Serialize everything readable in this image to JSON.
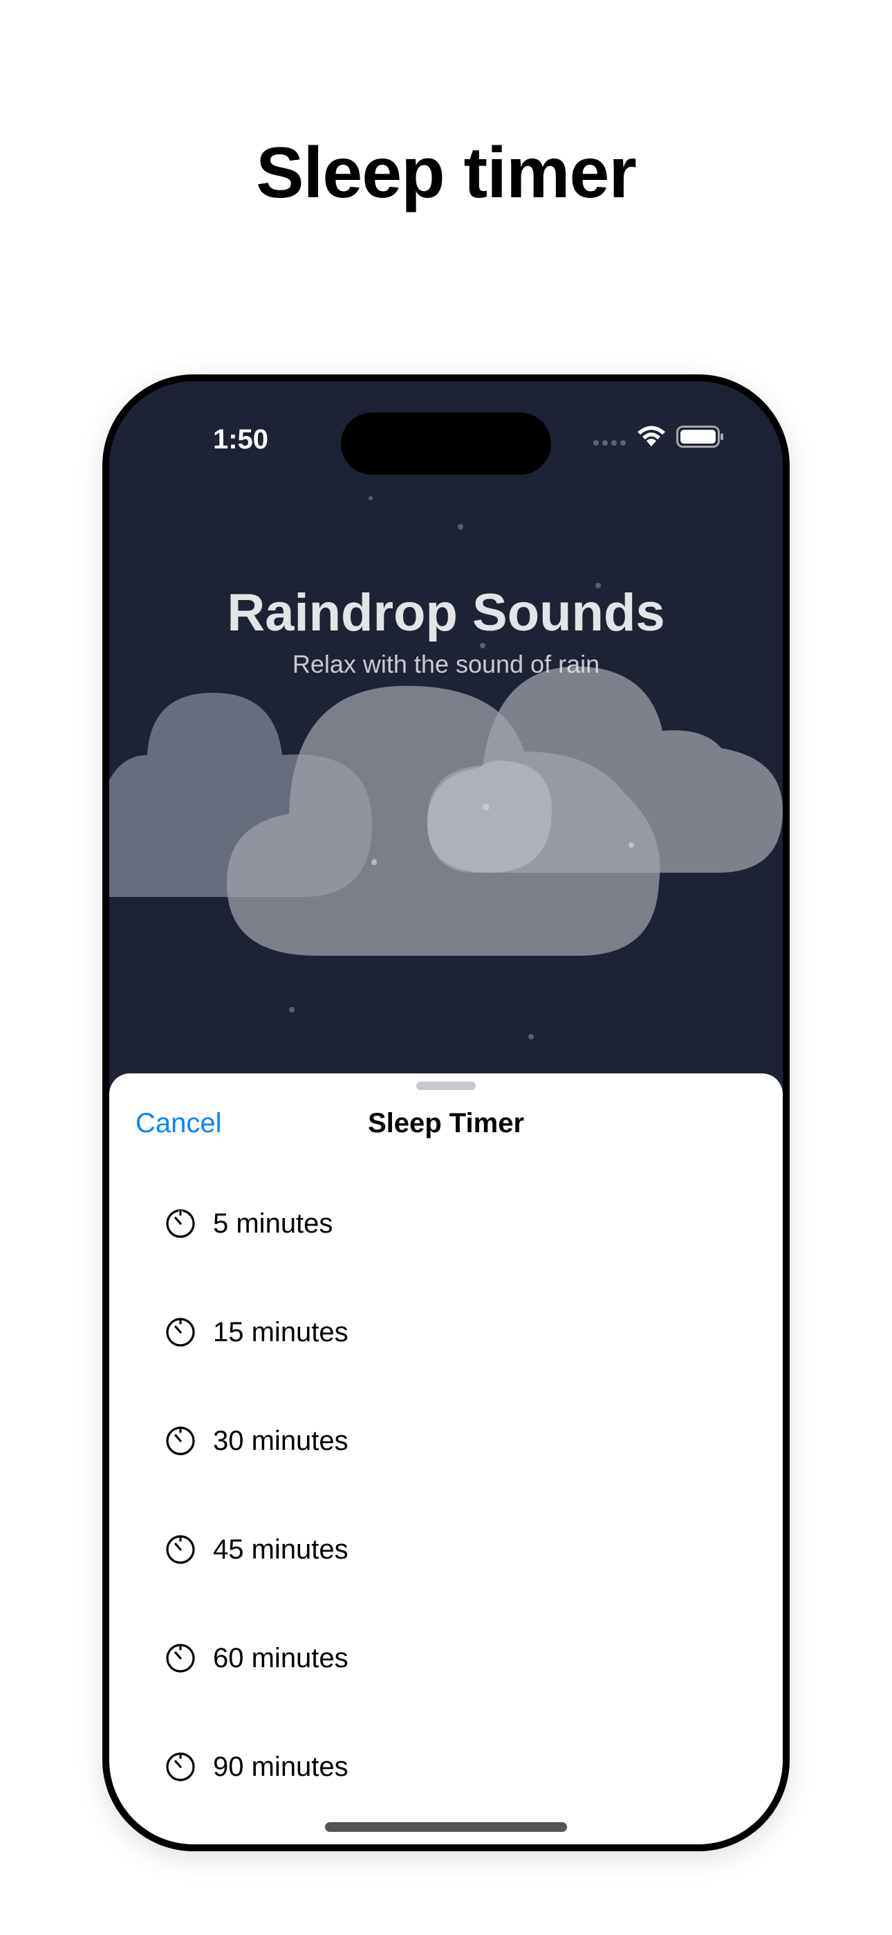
{
  "promo": {
    "title": "Sleep timer"
  },
  "status_bar": {
    "time": "1:50",
    "icons": [
      "cellular-signal-icon",
      "wifi-icon",
      "battery-icon"
    ]
  },
  "app": {
    "title": "Raindrop Sounds",
    "subtitle": "Relax with the sound of rain",
    "background_color": "#1d2334"
  },
  "sheet": {
    "cancel_label": "Cancel",
    "title": "Sleep Timer",
    "accent_color": "#0a84ff",
    "options": [
      {
        "label": "5 minutes",
        "icon": "timer-icon"
      },
      {
        "label": "15 minutes",
        "icon": "timer-icon"
      },
      {
        "label": "30 minutes",
        "icon": "timer-icon"
      },
      {
        "label": "45 minutes",
        "icon": "timer-icon"
      },
      {
        "label": "60 minutes",
        "icon": "timer-icon"
      },
      {
        "label": "90 minutes",
        "icon": "timer-icon"
      }
    ]
  }
}
